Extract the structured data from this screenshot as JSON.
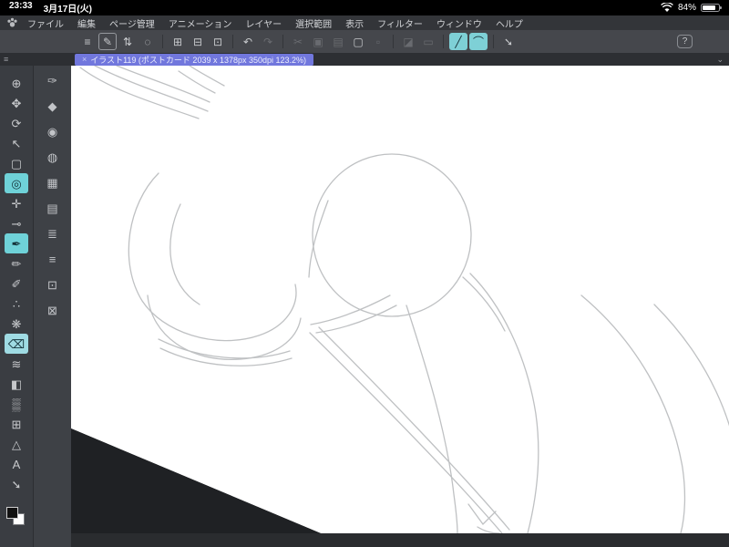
{
  "status_bar": {
    "time": "23:33",
    "date": "3月17日(火)",
    "battery_percent": "84%"
  },
  "menu_bar": {
    "items": [
      "ファイル",
      "編集",
      "ページ管理",
      "アニメーション",
      "レイヤー",
      "選択範囲",
      "表示",
      "フィルター",
      "ウィンドウ",
      "ヘルプ"
    ]
  },
  "toolbar": {
    "buttons": [
      {
        "name": "main-menu-button",
        "glyph": "≡",
        "state": "normal"
      },
      {
        "name": "tool-property-button",
        "glyph": "✎",
        "state": "outlined"
      },
      {
        "name": "brush-size-stepper",
        "glyph": "⇅",
        "state": "normal"
      },
      {
        "name": "stabilization-button",
        "glyph": "◌",
        "state": "normal"
      },
      {
        "name": "separator",
        "glyph": "",
        "state": "sep"
      },
      {
        "name": "new-file-button",
        "glyph": "⊞",
        "state": "normal"
      },
      {
        "name": "open-file-button",
        "glyph": "⊟",
        "state": "normal"
      },
      {
        "name": "save-file-button",
        "glyph": "⊡",
        "state": "normal"
      },
      {
        "name": "separator",
        "glyph": "",
        "state": "sep"
      },
      {
        "name": "undo-button",
        "glyph": "↶",
        "state": "normal"
      },
      {
        "name": "redo-button",
        "glyph": "↷",
        "state": "disabled"
      },
      {
        "name": "separator",
        "glyph": "",
        "state": "sep"
      },
      {
        "name": "cut-button",
        "glyph": "✂",
        "state": "disabled"
      },
      {
        "name": "copy-button",
        "glyph": "▣",
        "state": "disabled"
      },
      {
        "name": "paste-button",
        "glyph": "▤",
        "state": "disabled"
      },
      {
        "name": "selection-button",
        "glyph": "▢",
        "state": "normal"
      },
      {
        "name": "deselect-button",
        "glyph": "▫",
        "state": "disabled"
      },
      {
        "name": "separator",
        "glyph": "",
        "state": "sep"
      },
      {
        "name": "invert-selection-button",
        "glyph": "◪",
        "state": "disabled"
      },
      {
        "name": "selection-border-button",
        "glyph": "▭",
        "state": "disabled"
      },
      {
        "name": "separator",
        "glyph": "",
        "state": "sep"
      },
      {
        "name": "snap-to-ruler-button",
        "glyph": "╱",
        "state": "active"
      },
      {
        "name": "snap-to-special-ruler-button",
        "glyph": "⌒",
        "state": "active"
      },
      {
        "name": "separator",
        "glyph": "",
        "state": "sep"
      },
      {
        "name": "vector-line-correct-button",
        "glyph": "➘",
        "state": "normal"
      },
      {
        "name": "help-button",
        "glyph": "?",
        "state": "normal"
      }
    ]
  },
  "tab_bar": {
    "rail_menu_glyph": "≡",
    "close_glyph": "×",
    "title": "イラスト119 (ポストカード 2039 x 1378px 350dpi 123.2%)",
    "collapse_glyph": "⌄"
  },
  "tool_palette": {
    "tools": [
      {
        "name": "zoom-tool",
        "glyph": "⊕",
        "state": "normal"
      },
      {
        "name": "hand-tool",
        "glyph": "✥",
        "state": "normal"
      },
      {
        "name": "rotate-tool",
        "glyph": "⟳",
        "state": "normal"
      },
      {
        "name": "operation-tool",
        "glyph": "↖",
        "state": "normal"
      },
      {
        "name": "selection-tool",
        "glyph": "▢",
        "state": "normal"
      },
      {
        "name": "auto-select-tool",
        "glyph": "◎",
        "state": "selected-teal"
      },
      {
        "name": "layer-move-tool",
        "glyph": "✛",
        "state": "normal"
      },
      {
        "name": "eyedropper-tool",
        "glyph": "⊸",
        "state": "normal"
      },
      {
        "name": "pen-tool",
        "glyph": "✒",
        "state": "selected-teal"
      },
      {
        "name": "pencil-tool",
        "glyph": "✏",
        "state": "normal"
      },
      {
        "name": "brush-tool",
        "glyph": "✐",
        "state": "normal"
      },
      {
        "name": "airbrush-tool",
        "glyph": "∴",
        "state": "normal"
      },
      {
        "name": "decoration-tool",
        "glyph": "❋",
        "state": "normal"
      },
      {
        "name": "eraser-tool",
        "glyph": "⌫",
        "state": "selected-blue"
      },
      {
        "name": "blend-tool",
        "glyph": "≋",
        "state": "normal"
      },
      {
        "name": "fill-tool",
        "glyph": "◧",
        "state": "normal"
      },
      {
        "name": "gradient-tool",
        "glyph": "▒",
        "state": "normal"
      },
      {
        "name": "frame-border-tool",
        "glyph": "⊞",
        "state": "normal"
      },
      {
        "name": "figure-tool",
        "glyph": "△",
        "state": "normal"
      },
      {
        "name": "text-tool",
        "glyph": "A",
        "state": "normal"
      },
      {
        "name": "line-correct-tool",
        "glyph": "➘",
        "state": "normal"
      }
    ]
  },
  "sub_palette": {
    "items": [
      {
        "name": "subtool-pen-settings",
        "glyph": "✑"
      },
      {
        "name": "subtool-ink",
        "glyph": "◆"
      },
      {
        "name": "subtool-opacity",
        "glyph": "◉"
      },
      {
        "name": "subtool-tone",
        "glyph": "◍"
      },
      {
        "name": "subtool-screen",
        "glyph": "▦"
      },
      {
        "name": "subtool-film",
        "glyph": "▤"
      },
      {
        "name": "subtool-layer-list",
        "glyph": "≣"
      },
      {
        "name": "subtool-layer-property",
        "glyph": "≡"
      },
      {
        "name": "subtool-favorites-1",
        "glyph": "⊡"
      },
      {
        "name": "subtool-favorites-2",
        "glyph": "⊠"
      }
    ]
  },
  "colors": {
    "accent_teal": "#7ed0d6",
    "tab_blue": "#7177dd",
    "canvas": "#ffffff",
    "sketch_line": "#bfc1c3",
    "main_color": "#111111",
    "sub_color": "#ffffff"
  }
}
